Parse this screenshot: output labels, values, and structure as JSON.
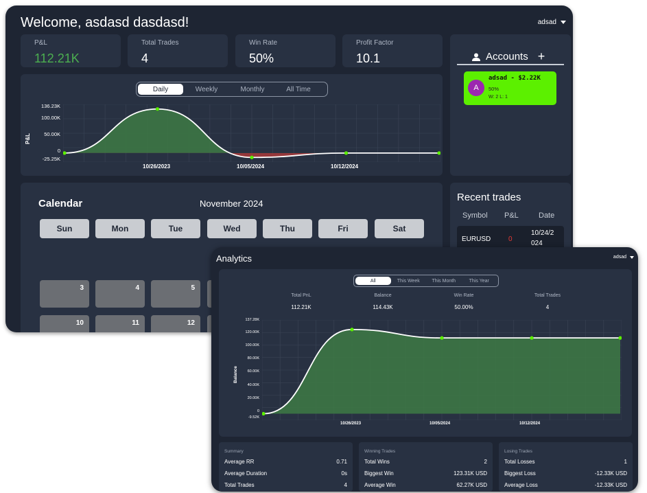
{
  "dashboard": {
    "welcome": "Welcome, asdasd dasdasd!",
    "user": "adsad",
    "stats": [
      {
        "label": "P&L",
        "value": "112.21K"
      },
      {
        "label": "Total Trades",
        "value": "4"
      },
      {
        "label": "Win Rate",
        "value": "50%"
      },
      {
        "label": "Profit Factor",
        "value": "10.1"
      }
    ],
    "ranges": [
      "Daily",
      "Weekly",
      "Monthly",
      "All Time"
    ],
    "accounts": {
      "title": "Accounts",
      "card": {
        "avatar": "A",
        "name": "adsad - $2.22K",
        "win_rate": "50%",
        "wl": "W: 2 L: 1",
        "color": "#5cf000"
      }
    },
    "calendar": {
      "title": "Calendar",
      "month": "November 2024",
      "days": [
        "Sun",
        "Mon",
        "Tue",
        "Wed",
        "Thu",
        "Fri",
        "Sat"
      ],
      "dates_row1": [
        "3",
        "4",
        "5"
      ],
      "dates_row2": [
        "10",
        "11",
        "12"
      ]
    },
    "recent": {
      "title": "Recent trades",
      "headers": [
        "Symbol",
        "P&L",
        "Date"
      ],
      "row": {
        "symbol": "EURUSD",
        "pnl": "0",
        "date_line1": "10/24/2",
        "date_line2": "024"
      }
    }
  },
  "analytics": {
    "title": "Analytics",
    "user": "adsad",
    "ranges": [
      "All",
      "This Week",
      "This Month",
      "This Year"
    ],
    "summary": [
      {
        "label": "Total PnL",
        "value": "112.21K"
      },
      {
        "label": "Balance",
        "value": "114.43K"
      },
      {
        "label": "Win Rate",
        "value": "50.00%"
      },
      {
        "label": "Total Trades",
        "value": "4"
      }
    ],
    "cards": {
      "summary": {
        "title": "Summary",
        "rows": [
          [
            "Average RR",
            "0.71"
          ],
          [
            "Average Duration",
            "0s"
          ],
          [
            "Total Trades",
            "4"
          ]
        ]
      },
      "winning": {
        "title": "Winning Trades",
        "rows": [
          [
            "Total Wins",
            "2"
          ],
          [
            "Biggest Win",
            "123.31K USD"
          ],
          [
            "Average Win",
            "62.27K USD"
          ]
        ]
      },
      "losing": {
        "title": "Losing Trades",
        "rows": [
          [
            "Total Losses",
            "1"
          ],
          [
            "Biggest Loss",
            "-12.33K USD"
          ],
          [
            "Average Loss",
            "-12.33K USD"
          ]
        ]
      }
    }
  },
  "chart_data": [
    {
      "type": "area",
      "x": [
        "10/26/2023",
        "",
        "10/05/2024",
        "",
        "10/12/2024"
      ],
      "values": [
        0,
        123.31,
        -12.33,
        0,
        0
      ],
      "xticks": [
        "10/26/2023",
        "10/05/2024",
        "10/12/2024"
      ],
      "yticks": [
        "136.23K",
        "100.00K",
        "50.00K",
        "0",
        "-25.25K"
      ],
      "ylim": [
        -25.25,
        136.23
      ],
      "ylabel": "P&L",
      "grid": true,
      "colors": {
        "positive": "#3d7a44",
        "negative": "#a83a3a",
        "line": "#ffffff",
        "point": "#5cf000"
      }
    },
    {
      "type": "area",
      "x": [
        "10/26/2023",
        "",
        "10/05/2024",
        "",
        "10/12/2024"
      ],
      "values": [
        0,
        123.31,
        110.98,
        110.98,
        110.98
      ],
      "xticks": [
        "10/26/2023",
        "10/05/2024",
        "10/12/2024"
      ],
      "yticks": [
        "137.28K",
        "120.00K",
        "100.00K",
        "80.00K",
        "60.00K",
        "40.00K",
        "20.00K",
        "0",
        "-9.52K"
      ],
      "ylim": [
        -9.52,
        137.28
      ],
      "ylabel": "Balance",
      "grid": true,
      "colors": {
        "fill": "#3d7a44",
        "line": "#ffffff",
        "point": "#5cf000"
      }
    }
  ]
}
